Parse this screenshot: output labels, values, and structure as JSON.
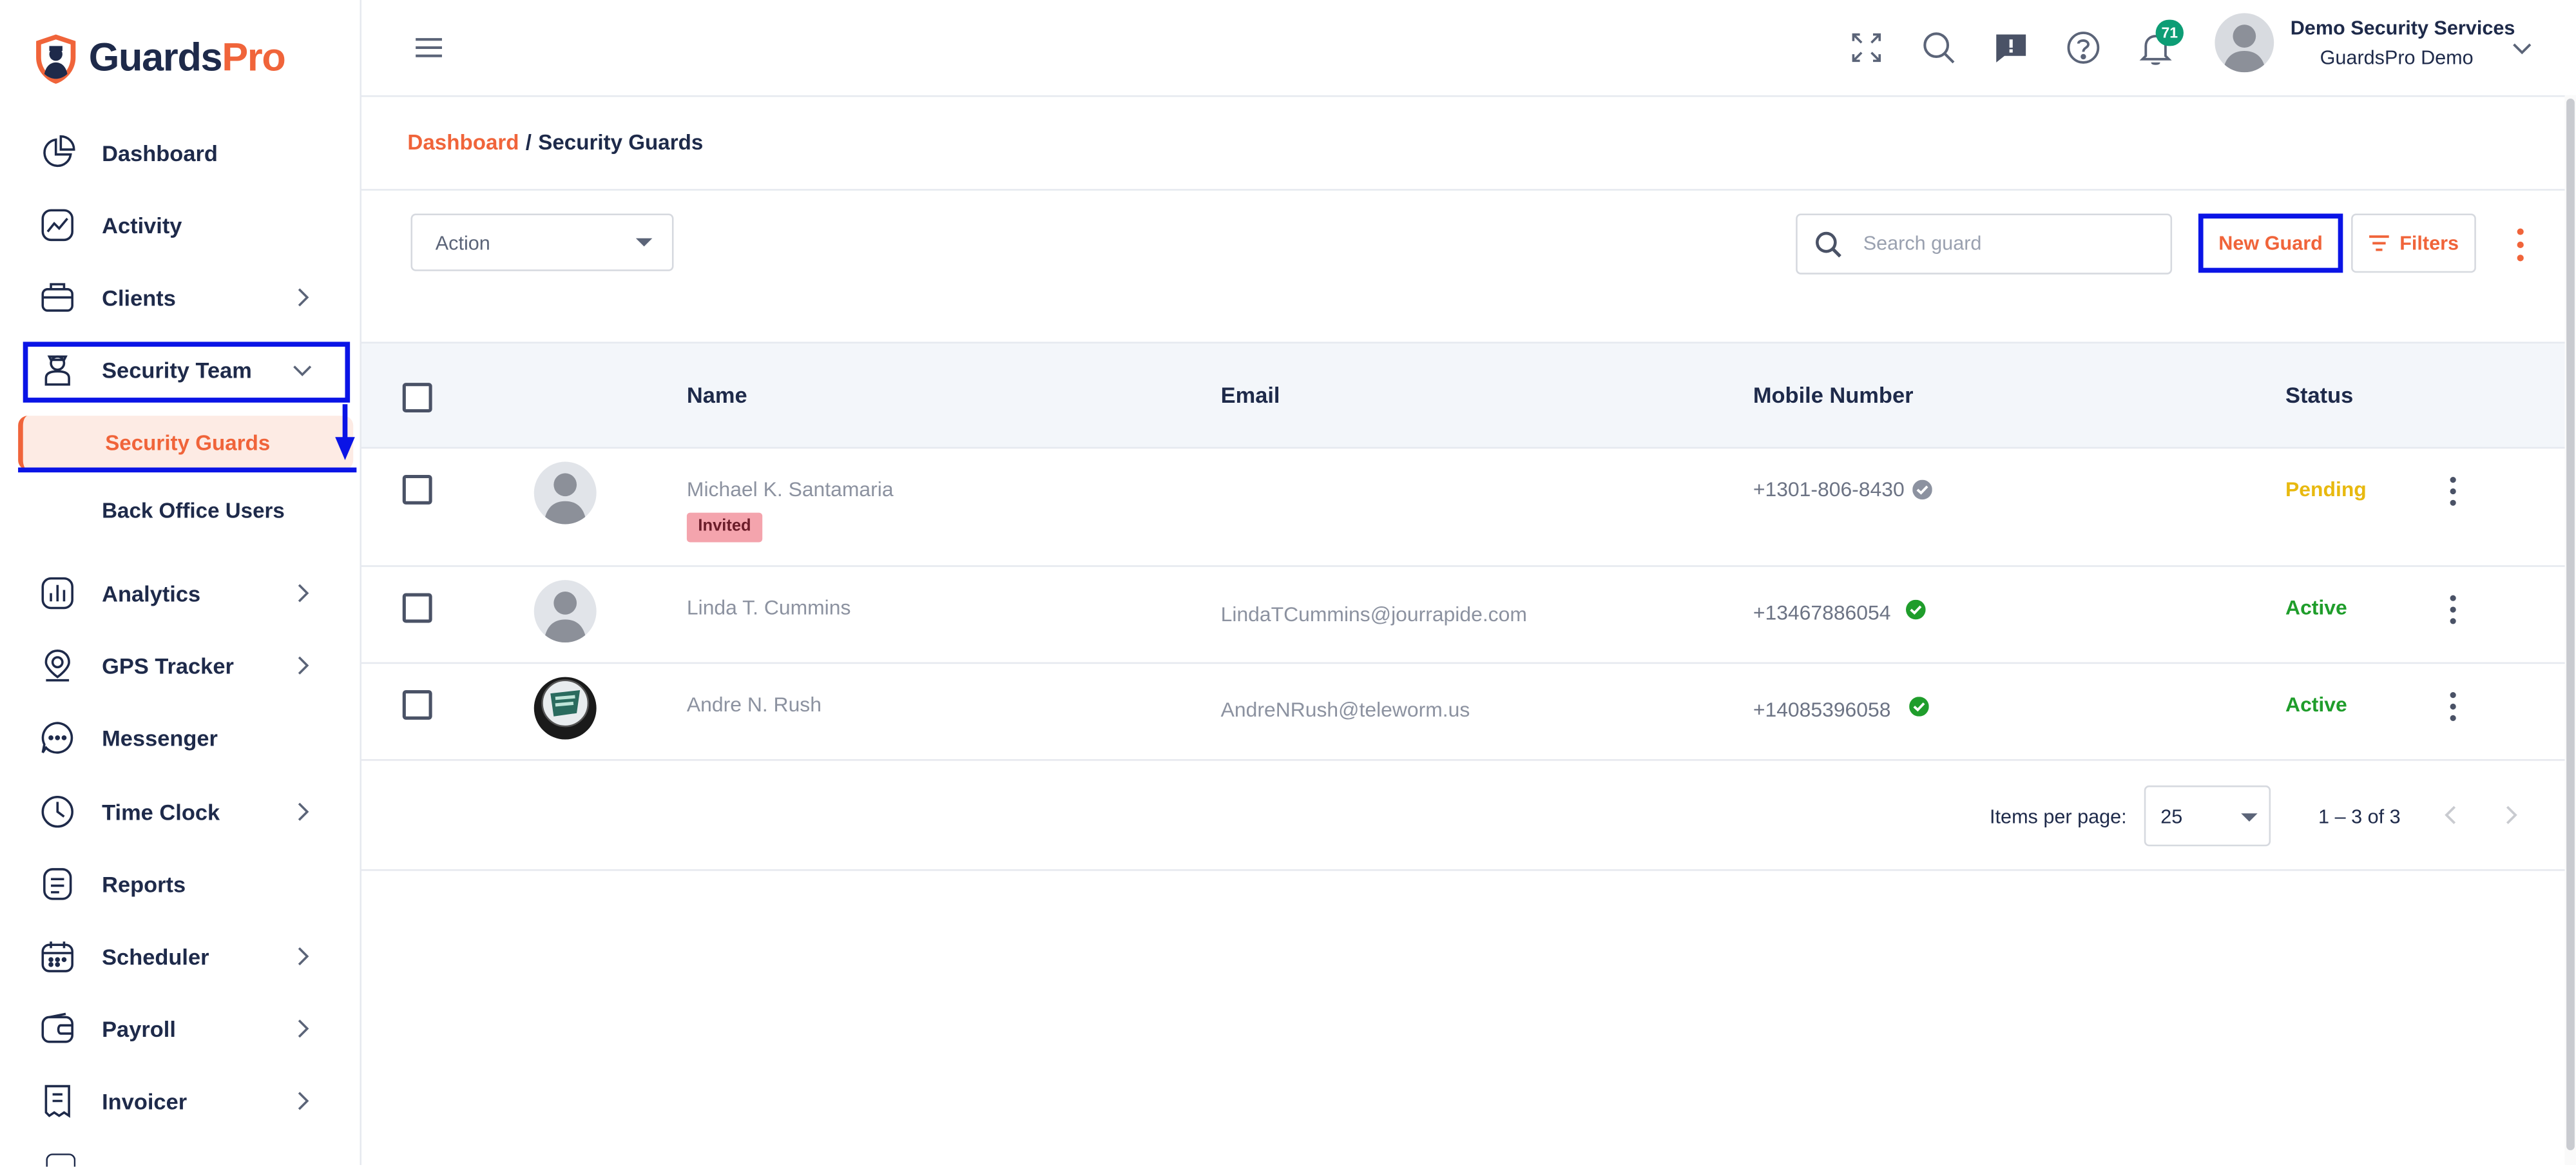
{
  "app": {
    "logo_left": "Guards",
    "logo_right": "Pro"
  },
  "sidebar": {
    "items": [
      {
        "label": "Dashboard",
        "icon": "dashboard-icon"
      },
      {
        "label": "Activity",
        "icon": "activity-icon"
      },
      {
        "label": "Clients",
        "icon": "clients-icon"
      },
      {
        "label": "Security Team",
        "icon": "security-team-icon"
      },
      {
        "label": "Analytics",
        "icon": "analytics-icon"
      },
      {
        "label": "GPS Tracker",
        "icon": "gps-icon"
      },
      {
        "label": "Messenger",
        "icon": "messenger-icon"
      },
      {
        "label": "Time Clock",
        "icon": "clock-icon"
      },
      {
        "label": "Reports",
        "icon": "reports-icon"
      },
      {
        "label": "Scheduler",
        "icon": "calendar-icon"
      },
      {
        "label": "Payroll",
        "icon": "wallet-icon"
      },
      {
        "label": "Invoicer",
        "icon": "invoice-icon"
      }
    ],
    "sub_items": [
      {
        "label": "Security Guards",
        "active": true
      },
      {
        "label": "Back Office Users",
        "active": false
      }
    ]
  },
  "topbar": {
    "notification_count": "71",
    "user_name": "Demo Security Services",
    "user_org": "GuardsPro Demo"
  },
  "breadcrumb": {
    "root": "Dashboard",
    "separator": "/",
    "current": "Security Guards"
  },
  "toolbar": {
    "action_label": "Action",
    "search_placeholder": "Search guard",
    "new_guard_label": "New Guard",
    "filters_label": "Filters"
  },
  "table": {
    "columns": [
      "Name",
      "Email",
      "Mobile Number",
      "Status"
    ],
    "rows": [
      {
        "name": "Michael K. Santamaria",
        "badge": "Invited",
        "email": "",
        "mobile": "+1301-806-8430",
        "verified": false,
        "status": "Pending",
        "status_color": "#e8b90f"
      },
      {
        "name": "Linda T. Cummins",
        "badge": "",
        "email": "LindaTCummins@jourrapide.com",
        "mobile": "+13467886054",
        "verified": true,
        "status": "Active",
        "status_color": "#1f9d2b"
      },
      {
        "name": "Andre N. Rush",
        "badge": "",
        "email": "AndreNRush@teleworm.us",
        "mobile": "+14085396058",
        "verified": true,
        "status": "Active",
        "status_color": "#1f9d2b"
      }
    ]
  },
  "pagination": {
    "items_per_page_label": "Items per page:",
    "items_per_page": "25",
    "range": "1 – 3 of 3"
  },
  "colors": {
    "accent": "#f0643a",
    "navy": "#1e2a4a",
    "highlight": "#0a14e6"
  }
}
